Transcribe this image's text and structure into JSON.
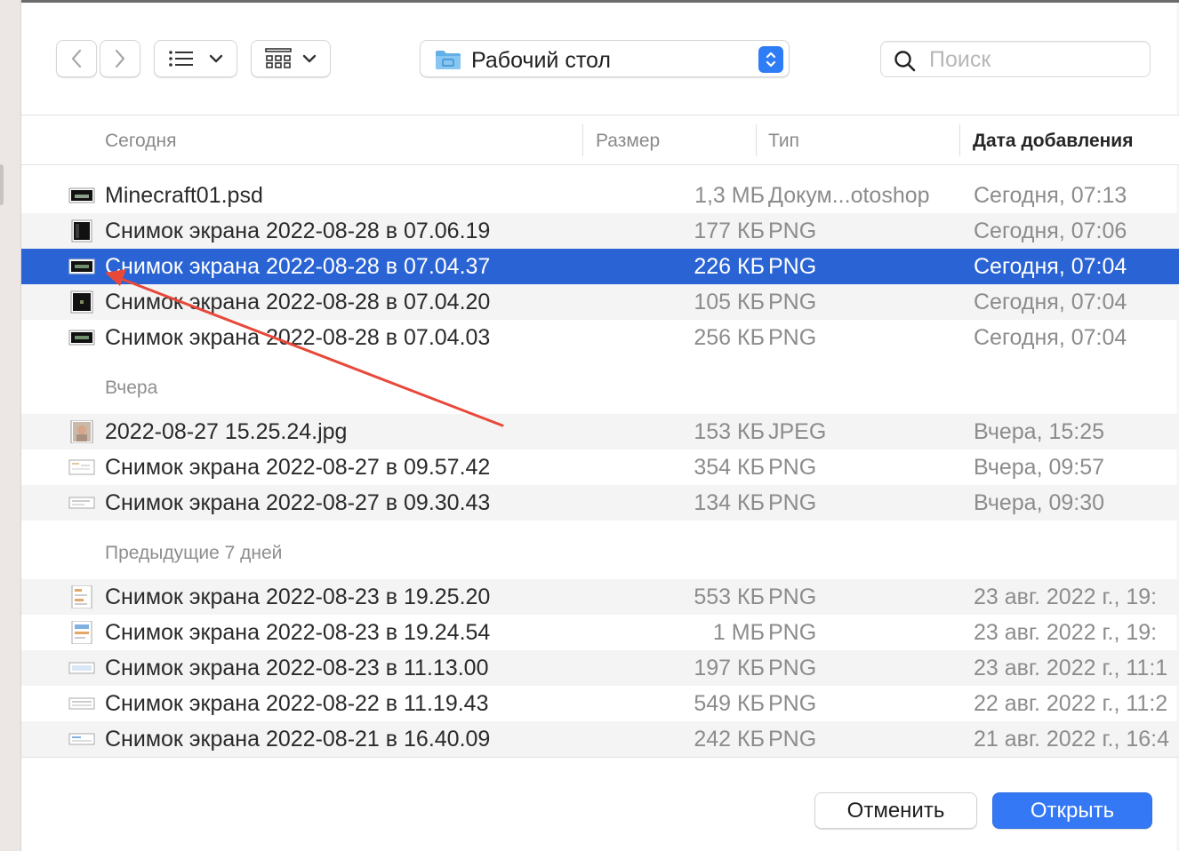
{
  "toolbar": {
    "location": "Рабочий стол",
    "search_placeholder": "Поиск"
  },
  "columns": {
    "name": "Сегодня",
    "size": "Размер",
    "kind": "Тип",
    "date": "Дата добавления"
  },
  "groups": {
    "today": "Сегодня",
    "yesterday": "Вчера",
    "previous": "Предыдущие 7 дней"
  },
  "files": [
    {
      "name": "Minecraft01.psd",
      "size": "1,3 МБ",
      "kind": "Докум...otoshop",
      "date": "Сегодня, 07:13",
      "icon": "psd-thumbnail-icon"
    },
    {
      "name": "Снимок экрана 2022-08-28 в 07.06.19",
      "size": "177 КБ",
      "kind": "PNG",
      "date": "Сегодня, 07:06",
      "icon": "png-thumbnail-icon"
    },
    {
      "name": "Снимок экрана 2022-08-28 в 07.04.37",
      "size": "226 КБ",
      "kind": "PNG",
      "date": "Сегодня, 07:04",
      "icon": "png-thumbnail-icon",
      "selected": true
    },
    {
      "name": "Снимок экрана 2022-08-28 в 07.04.20",
      "size": "105 КБ",
      "kind": "PNG",
      "date": "Сегодня, 07:04",
      "icon": "png-thumbnail-icon"
    },
    {
      "name": "Снимок экрана 2022-08-28 в 07.04.03",
      "size": "256 КБ",
      "kind": "PNG",
      "date": "Сегодня, 07:04",
      "icon": "png-thumbnail-icon"
    },
    {
      "name": "2022-08-27 15.25.24.jpg",
      "size": "153 КБ",
      "kind": "JPEG",
      "date": "Вчера, 15:25",
      "icon": "jpeg-thumbnail-icon"
    },
    {
      "name": "Снимок экрана 2022-08-27 в 09.57.42",
      "size": "354 КБ",
      "kind": "PNG",
      "date": "Вчера, 09:57",
      "icon": "png-thumbnail-icon"
    },
    {
      "name": "Снимок экрана 2022-08-27 в 09.30.43",
      "size": "134 КБ",
      "kind": "PNG",
      "date": "Вчера, 09:30",
      "icon": "png-thumbnail-icon"
    },
    {
      "name": "Снимок экрана 2022-08-23 в 19.25.20",
      "size": "553 КБ",
      "kind": "PNG",
      "date": "23 авг. 2022 г., 19:",
      "icon": "png-thumbnail-icon"
    },
    {
      "name": "Снимок экрана 2022-08-23 в 19.24.54",
      "size": "1 МБ",
      "kind": "PNG",
      "date": "23 авг. 2022 г., 19:",
      "icon": "png-thumbnail-icon"
    },
    {
      "name": "Снимок экрана 2022-08-23 в 11.13.00",
      "size": "197 КБ",
      "kind": "PNG",
      "date": "23 авг. 2022 г., 11:1",
      "icon": "png-thumbnail-icon"
    },
    {
      "name": "Снимок экрана 2022-08-22 в 11.19.43",
      "size": "549 КБ",
      "kind": "PNG",
      "date": "22 авг. 2022 г., 11:2",
      "icon": "png-thumbnail-icon"
    },
    {
      "name": "Снимок экрана 2022-08-21 в 16.40.09",
      "size": "242 КБ",
      "kind": "PNG",
      "date": "21 авг. 2022 г., 16:4",
      "icon": "png-thumbnail-icon"
    }
  ],
  "buttons": {
    "cancel": "Отменить",
    "open": "Открыть"
  },
  "colors": {
    "selection": "#2a63d4",
    "primary_button": "#3478f6",
    "annotation_arrow": "#e8483a"
  }
}
